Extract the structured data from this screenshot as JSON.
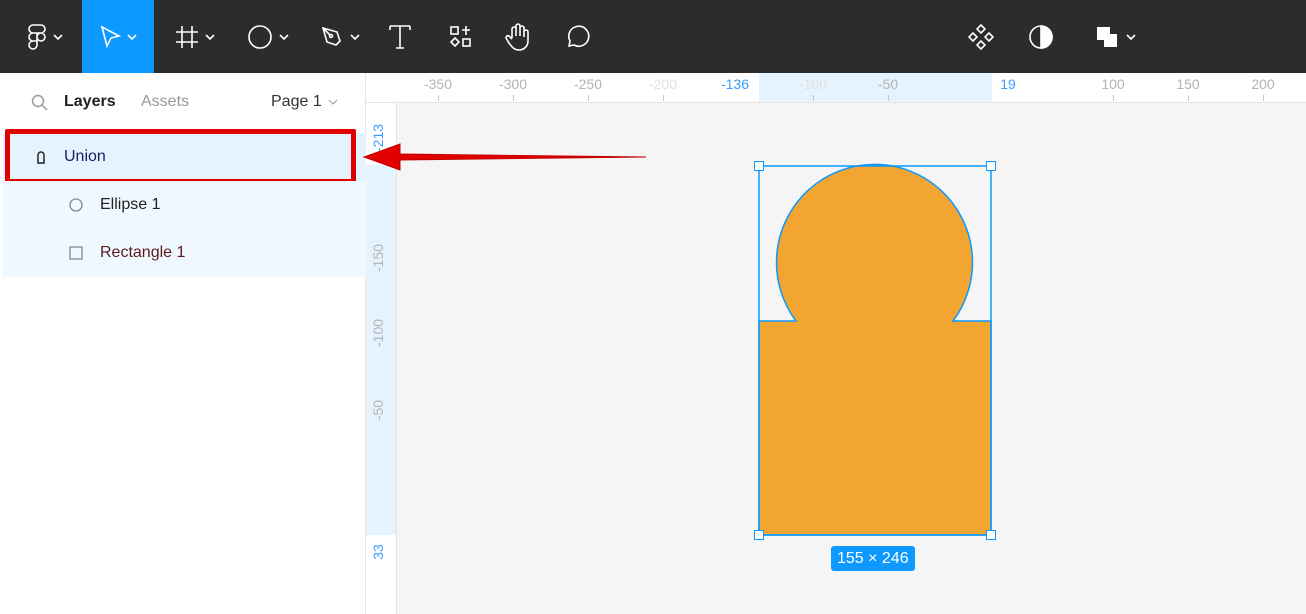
{
  "panel": {
    "tabs": {
      "layers": "Layers",
      "assets": "Assets"
    },
    "page": "Page 1"
  },
  "layers": [
    {
      "name": "Union",
      "icon": "lock-icon"
    },
    {
      "name": "Ellipse 1",
      "icon": "ellipse-icon"
    },
    {
      "name": "Rectangle 1",
      "icon": "rectangle-icon"
    }
  ],
  "ruler": {
    "h": [
      "-350",
      "-300",
      "-250",
      "-200",
      "-136",
      "-100",
      "-50",
      "19",
      "100",
      "150",
      "200"
    ],
    "v": [
      "-213",
      "-150",
      "-100",
      "-50",
      "0",
      "33"
    ]
  },
  "selection": {
    "size": "155 × 246"
  },
  "colors": {
    "accent": "#0d99ff",
    "shape": "#f2a531",
    "highlight": "#e10000"
  }
}
